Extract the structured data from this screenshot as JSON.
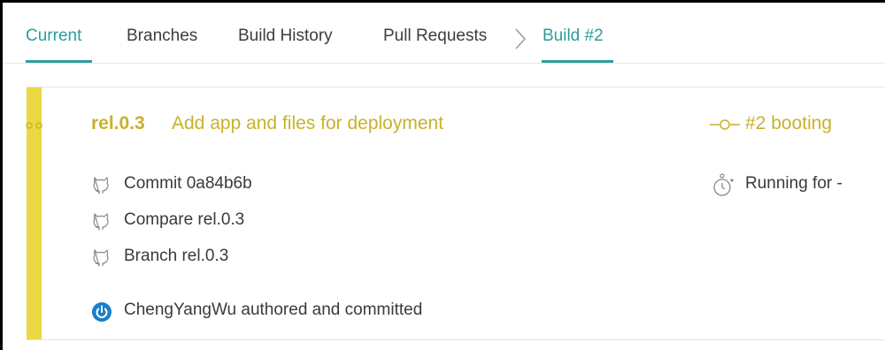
{
  "tabs": [
    {
      "label": "Current",
      "active": true
    },
    {
      "label": "Branches",
      "active": false
    },
    {
      "label": "Build History",
      "active": false
    },
    {
      "label": "Pull Requests",
      "active": false
    },
    {
      "label": "Build #2",
      "active": true
    }
  ],
  "build": {
    "branch": "rel.0.3",
    "message": "Add app and files for deployment",
    "status": "#2 booting",
    "links": [
      {
        "label": "Commit 0a84b6b",
        "icon": "github-icon"
      },
      {
        "label": "Compare rel.0.3",
        "icon": "github-icon"
      },
      {
        "label": "Branch rel.0.3",
        "icon": "github-icon"
      }
    ],
    "duration": "Running for -",
    "author": "ChengYangWu authored and committed"
  },
  "colors": {
    "accent_teal": "#2e9c9c",
    "status_yellow": "#ecd842",
    "status_text": "#c9b12a",
    "avatar_blue": "#1a7fc7"
  }
}
